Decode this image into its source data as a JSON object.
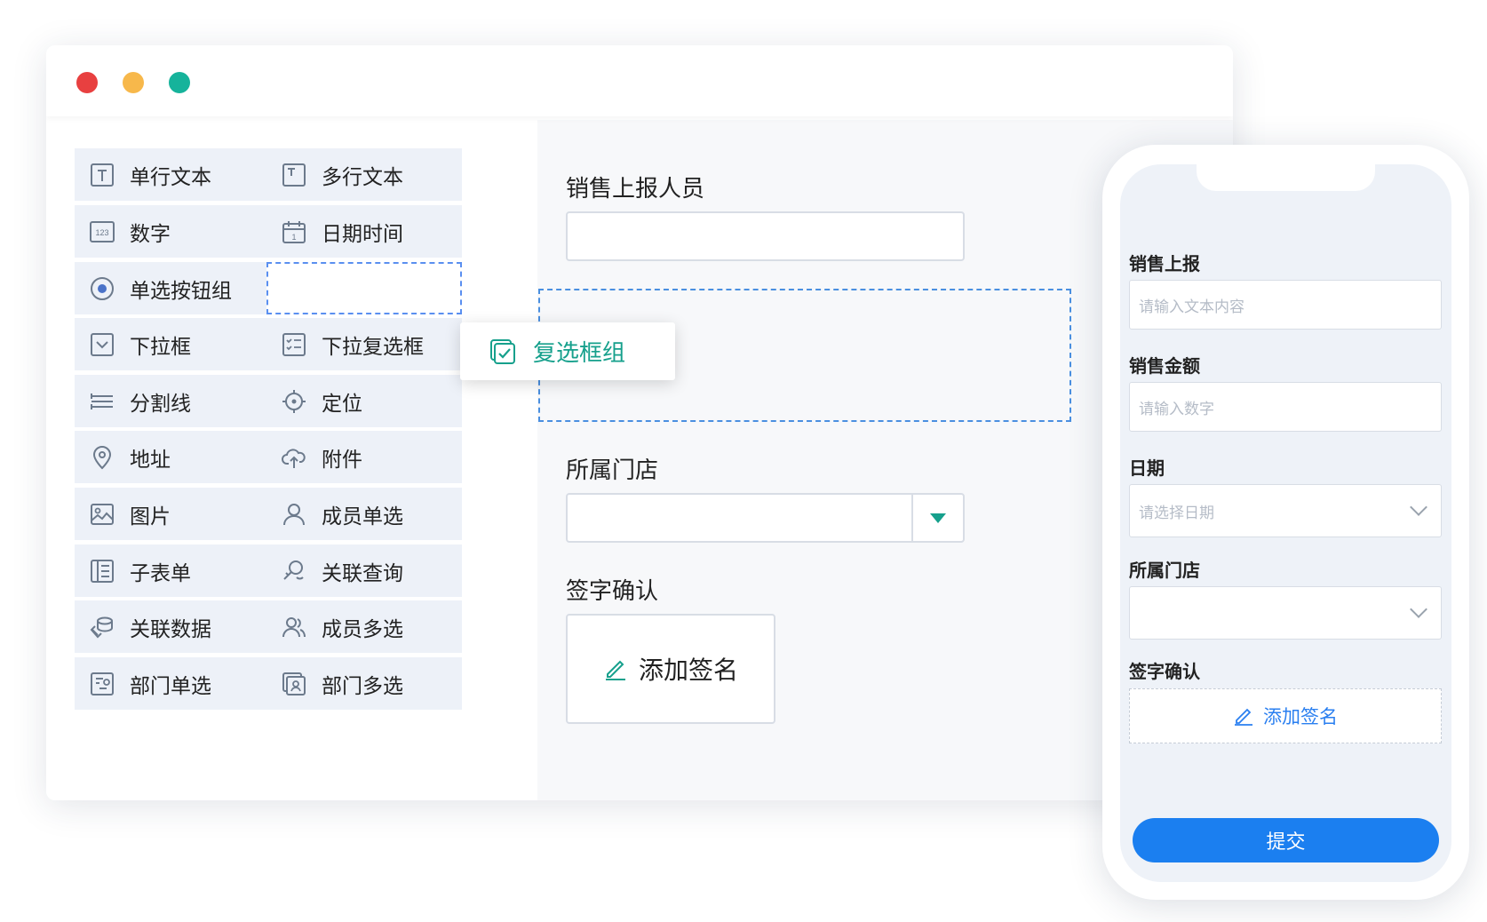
{
  "window": {
    "controls": [
      "close",
      "minimize",
      "maximize"
    ]
  },
  "palette": {
    "items": [
      {
        "label": "单行文本",
        "icon": "text-icon"
      },
      {
        "label": "多行文本",
        "icon": "textarea-icon"
      },
      {
        "label": "数字",
        "icon": "number-icon"
      },
      {
        "label": "日期时间",
        "icon": "calendar-icon"
      },
      {
        "label": "单选按钮组",
        "icon": "radio-icon"
      },
      {
        "label": "",
        "icon": ""
      },
      {
        "label": "下拉框",
        "icon": "dropdown-icon"
      },
      {
        "label": "下拉复选框",
        "icon": "checklist-icon"
      },
      {
        "label": "分割线",
        "icon": "divider-icon"
      },
      {
        "label": "定位",
        "icon": "locate-icon"
      },
      {
        "label": "地址",
        "icon": "map-pin-icon"
      },
      {
        "label": "附件",
        "icon": "upload-cloud-icon"
      },
      {
        "label": "图片",
        "icon": "image-icon"
      },
      {
        "label": "成员单选",
        "icon": "user-icon"
      },
      {
        "label": "子表单",
        "icon": "subform-icon"
      },
      {
        "label": "关联查询",
        "icon": "link-search-icon"
      },
      {
        "label": "关联数据",
        "icon": "link-data-icon"
      },
      {
        "label": "成员多选",
        "icon": "users-icon"
      },
      {
        "label": "部门单选",
        "icon": "department-icon"
      },
      {
        "label": "部门多选",
        "icon": "departments-icon"
      }
    ]
  },
  "dragging": {
    "label": "复选框组",
    "icon": "checkbox-group-icon",
    "accent": "#16a08c"
  },
  "canvas": {
    "field1_label": "销售上报人员",
    "field2_label": "所属门店",
    "field3_label": "签字确认",
    "sign_label": "添加签名"
  },
  "mobile": {
    "f1_label": "销售上报",
    "f1_placeholder": "请输入文本内容",
    "f2_label": "销售金额",
    "f2_placeholder": "请输入数字",
    "f3_label": "日期",
    "f3_placeholder": "请选择日期",
    "f4_label": "所属门店",
    "f4_placeholder": "",
    "f5_label": "签字确认",
    "sign_label": "添加签名",
    "submit_label": "提交",
    "submit_color": "#1b7ff0"
  }
}
